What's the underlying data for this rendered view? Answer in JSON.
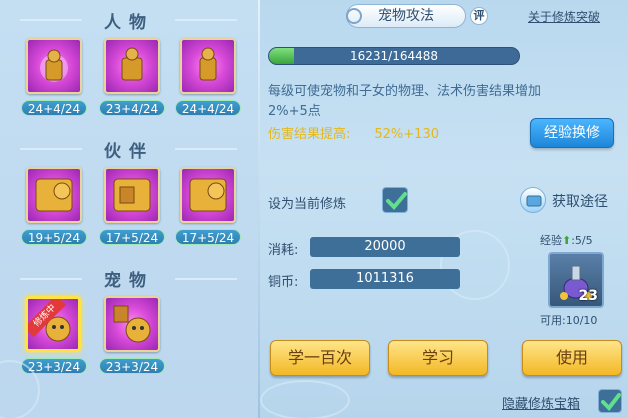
{
  "left_panel": {
    "sections": [
      {
        "title": "人物",
        "slots": [
          {
            "level": "24+4/24"
          },
          {
            "level": "23+4/24"
          },
          {
            "level": "24+4/24"
          }
        ]
      },
      {
        "title": "伙伴",
        "slots": [
          {
            "level": "19+5/24"
          },
          {
            "level": "17+5/24"
          },
          {
            "level": "17+5/24"
          }
        ]
      },
      {
        "title": "宠物",
        "slots": [
          {
            "level": "23+3/24",
            "tag": "修炼中"
          },
          {
            "level": "23+3/24"
          }
        ]
      }
    ]
  },
  "header": {
    "tab_title": "宠物攻法",
    "review_badge": "评",
    "link_about": "关于修炼突破"
  },
  "progress": {
    "text": "16231/164488",
    "fraction": 0.0987
  },
  "description": "每级可使宠物和子女的物理、法术伤害结果增加2%+5点",
  "boost": {
    "label": "伤害结果提高:",
    "value": "52%+130"
  },
  "buttons": {
    "exchange": "经验换修",
    "study_hundred": "学一百次",
    "study": "学习",
    "use": "使用"
  },
  "set_current": {
    "label": "设为当前修炼",
    "checked": true
  },
  "acquire": {
    "label": "获取途径"
  },
  "cost": {
    "label": "消耗:",
    "value": "20000"
  },
  "copper": {
    "label": "铜币:",
    "value": "1011316"
  },
  "exp_item": {
    "label": "经验",
    "value": ":5/5",
    "count": "23",
    "available": "可用:10/10"
  },
  "hide_treasure": {
    "label": "隐藏修炼宝箱",
    "checked": true
  }
}
